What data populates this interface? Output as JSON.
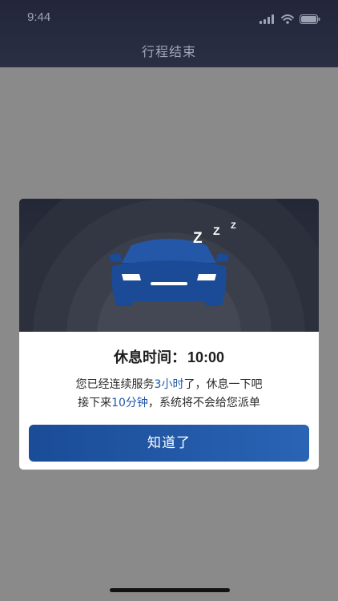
{
  "status_bar": {
    "time": "9:44"
  },
  "nav": {
    "title": "行程结束"
  },
  "modal": {
    "rest_label": "休息时间：",
    "rest_value": "10:00",
    "desc_line1": {
      "before": "您已经连续服务",
      "highlight": "3小时",
      "after": "了，休息一下吧"
    },
    "desc_line2": {
      "before": "接下来",
      "highlight": "10分钟",
      "after": "，系统将不会给您派单"
    },
    "confirm_label": "知道了",
    "sleep_letters": [
      "Z",
      "Z",
      "Z"
    ]
  },
  "colors": {
    "highlight": "#1f57a8",
    "button": "#1f56a5",
    "car": "#1b4a96",
    "nav_bg": "#262a3d"
  },
  "icons": [
    "signal-icon",
    "wifi-icon",
    "battery-icon",
    "car-icon",
    "sleep-z-icon"
  ]
}
